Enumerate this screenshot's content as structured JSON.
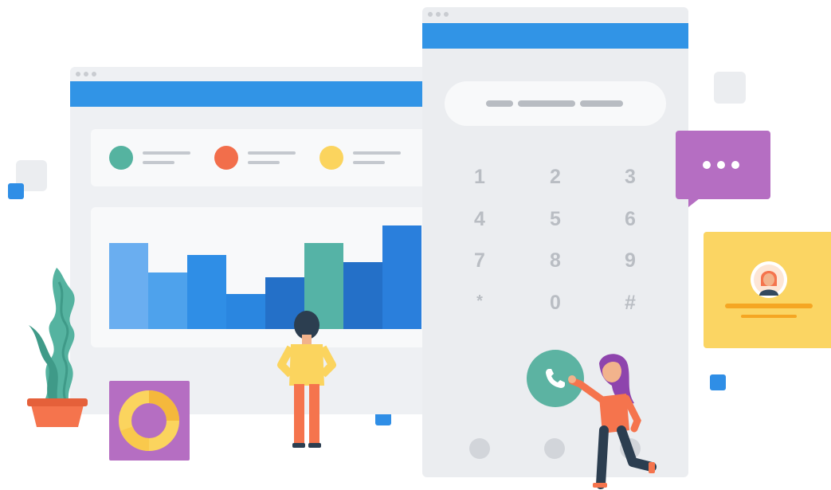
{
  "dialer": {
    "keys": [
      {
        "label": "1"
      },
      {
        "label": "2"
      },
      {
        "label": "3"
      },
      {
        "label": "4"
      },
      {
        "label": "5"
      },
      {
        "label": "6"
      },
      {
        "label": "7"
      },
      {
        "label": "8"
      },
      {
        "label": "9"
      },
      {
        "label": "*"
      },
      {
        "label": "0"
      },
      {
        "label": "#"
      }
    ],
    "call_icon": "phone-icon"
  },
  "dashboard": {
    "stat_colors": [
      "#55b3a0",
      "#f26e4b",
      "#fbd45e"
    ],
    "bar_colors": [
      "#6aaef0",
      "#4ea2ec",
      "#2f8ee6",
      "#2a86e0",
      "#2470c8",
      "#55b3a6",
      "#2470c8",
      "#2a7fdc"
    ]
  },
  "chat": {
    "icon": "ellipsis-icon"
  },
  "contact": {
    "icon": "avatar-icon"
  },
  "colors": {
    "accent_blue": "#3194e6",
    "teal": "#5cb3a2",
    "purple": "#b56ec2",
    "yellow": "#fbd563",
    "orange": "#f5744d"
  }
}
